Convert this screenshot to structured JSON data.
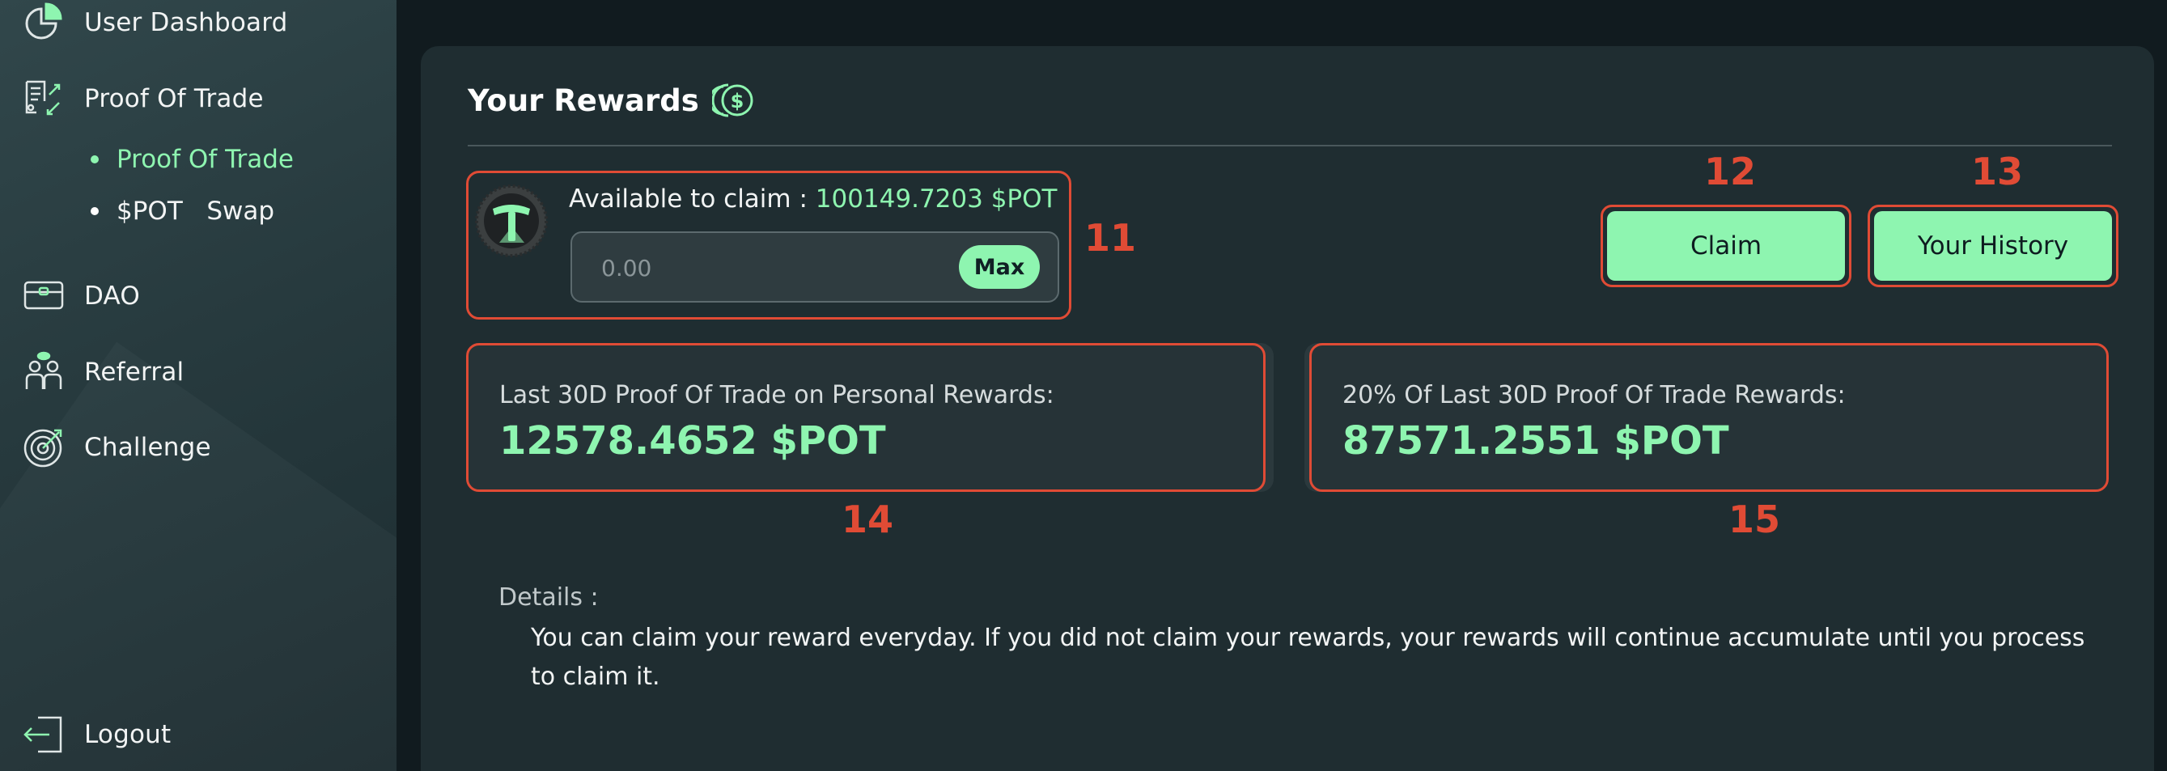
{
  "sidebar": {
    "items": [
      {
        "label": "User Dashboard",
        "icon": "pie-chart-icon"
      },
      {
        "label": "Proof Of Trade",
        "icon": "document-trade-icon"
      },
      {
        "label": "DAO",
        "icon": "wallet-card-icon"
      },
      {
        "label": "Referral",
        "icon": "people-icon"
      },
      {
        "label": "Challenge",
        "icon": "target-icon"
      },
      {
        "label": "Logout",
        "icon": "logout-icon"
      }
    ],
    "sub_items": [
      {
        "label": "Proof Of Trade",
        "active": true
      },
      {
        "label": "$POT   Swap",
        "active": false
      }
    ]
  },
  "rewards": {
    "title": "Your Rewards",
    "title_icon": "dollar-coins-icon",
    "available_label": "Available to claim : ",
    "available_amount": "100149.7203 $POT",
    "amount_placeholder": "0.00",
    "max_label": "Max",
    "claim_label": "Claim",
    "history_label": "Your History"
  },
  "stats": [
    {
      "caption": "Last 30D Proof Of Trade on Personal Rewards:",
      "value": "12578.4652 $POT"
    },
    {
      "caption": "20% Of Last 30D Proof Of Trade Rewards:",
      "value": "87571.2551 $POT"
    }
  ],
  "details": {
    "label": "Details :",
    "text": "You can claim your reward everyday. If you did not claim your rewards, your rewards will continue accumulate until you process to claim it."
  },
  "markers": [
    "11",
    "12",
    "13",
    "14",
    "15"
  ],
  "colors": {
    "accent": "#8ef5b0",
    "annotation": "#e04b35",
    "panel": "#1f2d31",
    "background": "#111b1f"
  }
}
